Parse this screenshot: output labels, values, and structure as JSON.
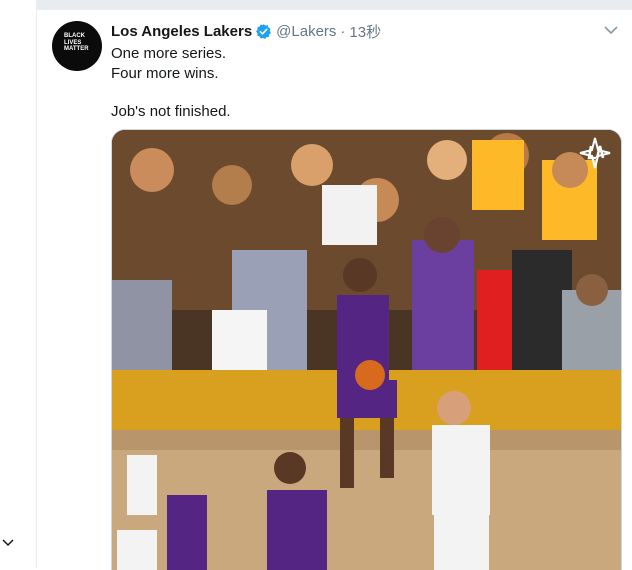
{
  "tweet": {
    "author_name": "Los Angeles Lakers",
    "handle": "@Lakers",
    "separator": "·",
    "time": "13秒",
    "lines": [
      "One more series.",
      "Four more wins.",
      "Job's not finished."
    ],
    "avatar_lines": [
      "BLACK",
      "LIVES",
      "MATTER"
    ]
  },
  "colors": {
    "verified": "#1da1f2",
    "text": "#14171a",
    "secondary": "#657786",
    "lakers_purple": "#552583",
    "lakers_gold": "#fdb927"
  },
  "icons": {
    "verified": "verified-badge-icon",
    "caret": "chevron-down-icon",
    "left_chevron": "chevron-down-icon"
  }
}
